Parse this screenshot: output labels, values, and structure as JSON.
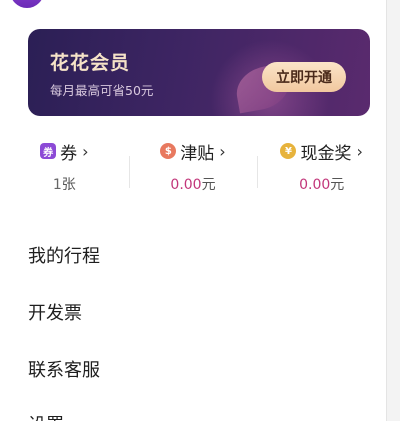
{
  "vip": {
    "title": "花花会员",
    "subtitle": "每月最高可省50元",
    "button_label": "立即开通"
  },
  "stats": [
    {
      "label": "券",
      "value": "1",
      "unit": "张",
      "icon": "coupon-icon"
    },
    {
      "label": "津贴",
      "value": "0.00",
      "unit": "元",
      "icon": "subsidy-icon"
    },
    {
      "label": "现金奖",
      "value": "0.00",
      "unit": "元",
      "icon": "cash-reward-icon"
    }
  ],
  "menu": [
    {
      "label": "我的行程"
    },
    {
      "label": "开发票"
    },
    {
      "label": "联系客服"
    },
    {
      "label": "设置"
    }
  ],
  "colors": {
    "accent": "#c2367a",
    "banner_dark": "#2b1f55",
    "banner_button": "#f1c89f"
  }
}
